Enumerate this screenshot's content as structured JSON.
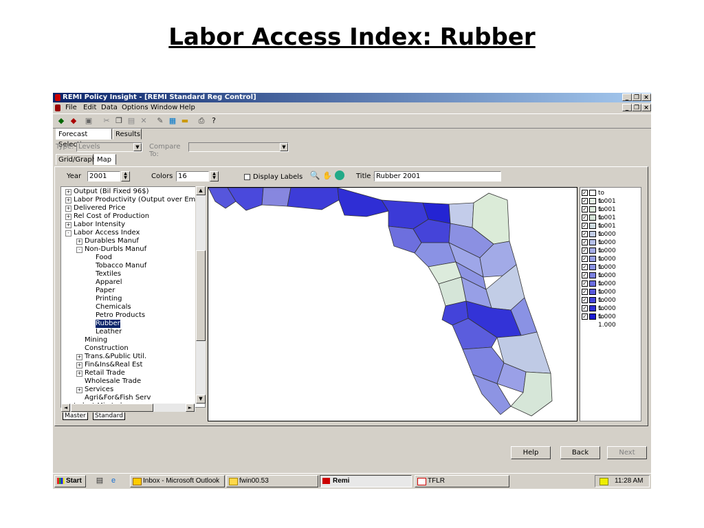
{
  "slide_title": "Labor Access Index: Rubber",
  "window": {
    "title": "REMI Policy Insight - [REMI Standard Reg Control]",
    "controls": {
      "minimize": "_",
      "restore": "❐",
      "close": "×"
    }
  },
  "menu": [
    "File",
    "Edit",
    "Data",
    "Options",
    "Window",
    "Help"
  ],
  "tabs_top": [
    "Forecast Selection",
    "Results"
  ],
  "type_row": {
    "type_label": "Type:",
    "type_value": "Levels",
    "compare_label": "Compare To:",
    "compare_value": ""
  },
  "tabs_view": [
    "Grid/Graph",
    "Map"
  ],
  "controls": {
    "year_label": "Year",
    "year_value": "2001",
    "colors_label": "Colors",
    "colors_value": "16",
    "display_labels": "Display Labels",
    "title_label": "Title :",
    "title_value": "Rubber  2001"
  },
  "tree": [
    {
      "label": "Output (Bil Fixed 96$)",
      "exp": "+"
    },
    {
      "label": "Labor Productivity (Output over Emp Th",
      "exp": "+"
    },
    {
      "label": "Delivered Price",
      "exp": "+"
    },
    {
      "label": "Rel Cost of Production",
      "exp": "+"
    },
    {
      "label": "Labor Intensity",
      "exp": "+"
    },
    {
      "label": "Labor Access Index",
      "exp": "-"
    },
    {
      "label": "Durables Manuf",
      "exp": "+"
    },
    {
      "label": "Non-Durbls Manuf",
      "exp": "-"
    },
    {
      "label": "Food",
      "exp": ""
    },
    {
      "label": "Tobacco Manuf",
      "exp": ""
    },
    {
      "label": "Textiles",
      "exp": ""
    },
    {
      "label": "Apparel",
      "exp": ""
    },
    {
      "label": "Paper",
      "exp": ""
    },
    {
      "label": "Printing",
      "exp": ""
    },
    {
      "label": "Chemicals",
      "exp": ""
    },
    {
      "label": "Petro Products",
      "exp": ""
    },
    {
      "label": "Rubber",
      "exp": ""
    },
    {
      "label": "Leather",
      "exp": ""
    },
    {
      "label": "Mining",
      "exp": ""
    },
    {
      "label": "Construction",
      "exp": ""
    },
    {
      "label": "Trans.&Public Util.",
      "exp": "+"
    },
    {
      "label": "Fin&Ins&Real Est",
      "exp": "+"
    },
    {
      "label": "Retail Trade",
      "exp": "+"
    },
    {
      "label": "Wholesale Trade",
      "exp": ""
    },
    {
      "label": "Services",
      "exp": "+"
    },
    {
      "label": "Agri&For&Fish Serv",
      "exp": ""
    },
    {
      "label": "Indust Mix Index",
      "exp": "+"
    }
  ],
  "sheet_tabs": [
    "Master",
    "Standard"
  ],
  "legend": [
    {
      "label": "to 1.001",
      "color": "#ffffff"
    },
    {
      "label": "to 1.001",
      "color": "#e6f2e6"
    },
    {
      "label": "to 1.001",
      "color": "#dcebdc"
    },
    {
      "label": "to 1.001",
      "color": "#d5e5d8"
    },
    {
      "label": "to 1.000",
      "color": "#cfdbe0"
    },
    {
      "label": "to 1.000",
      "color": "#c2cde6"
    },
    {
      "label": "to 1.000",
      "color": "#b4bfe8"
    },
    {
      "label": "to 1.000",
      "color": "#a5ade8"
    },
    {
      "label": "to 1.000",
      "color": "#979fe6"
    },
    {
      "label": "to 1.000",
      "color": "#8a92e4"
    },
    {
      "label": "to 1.000",
      "color": "#7c82e2"
    },
    {
      "label": "to 1.000",
      "color": "#6a6ddf"
    },
    {
      "label": "to 1.000",
      "color": "#5858dc"
    },
    {
      "label": "to 1.000",
      "color": "#4343da"
    },
    {
      "label": "to 1.000",
      "color": "#2f2fd6"
    },
    {
      "label": "to 1.000",
      "color": "#1c1cd2"
    }
  ],
  "nav_buttons": {
    "help": "Help",
    "back": "Back",
    "next": "Next"
  },
  "taskbar": {
    "start": "Start",
    "tasks": [
      "Inbox - Microsoft Outlook",
      "fwin00.53",
      "Remi",
      "TFLR"
    ],
    "clock": "11:28 AM"
  }
}
